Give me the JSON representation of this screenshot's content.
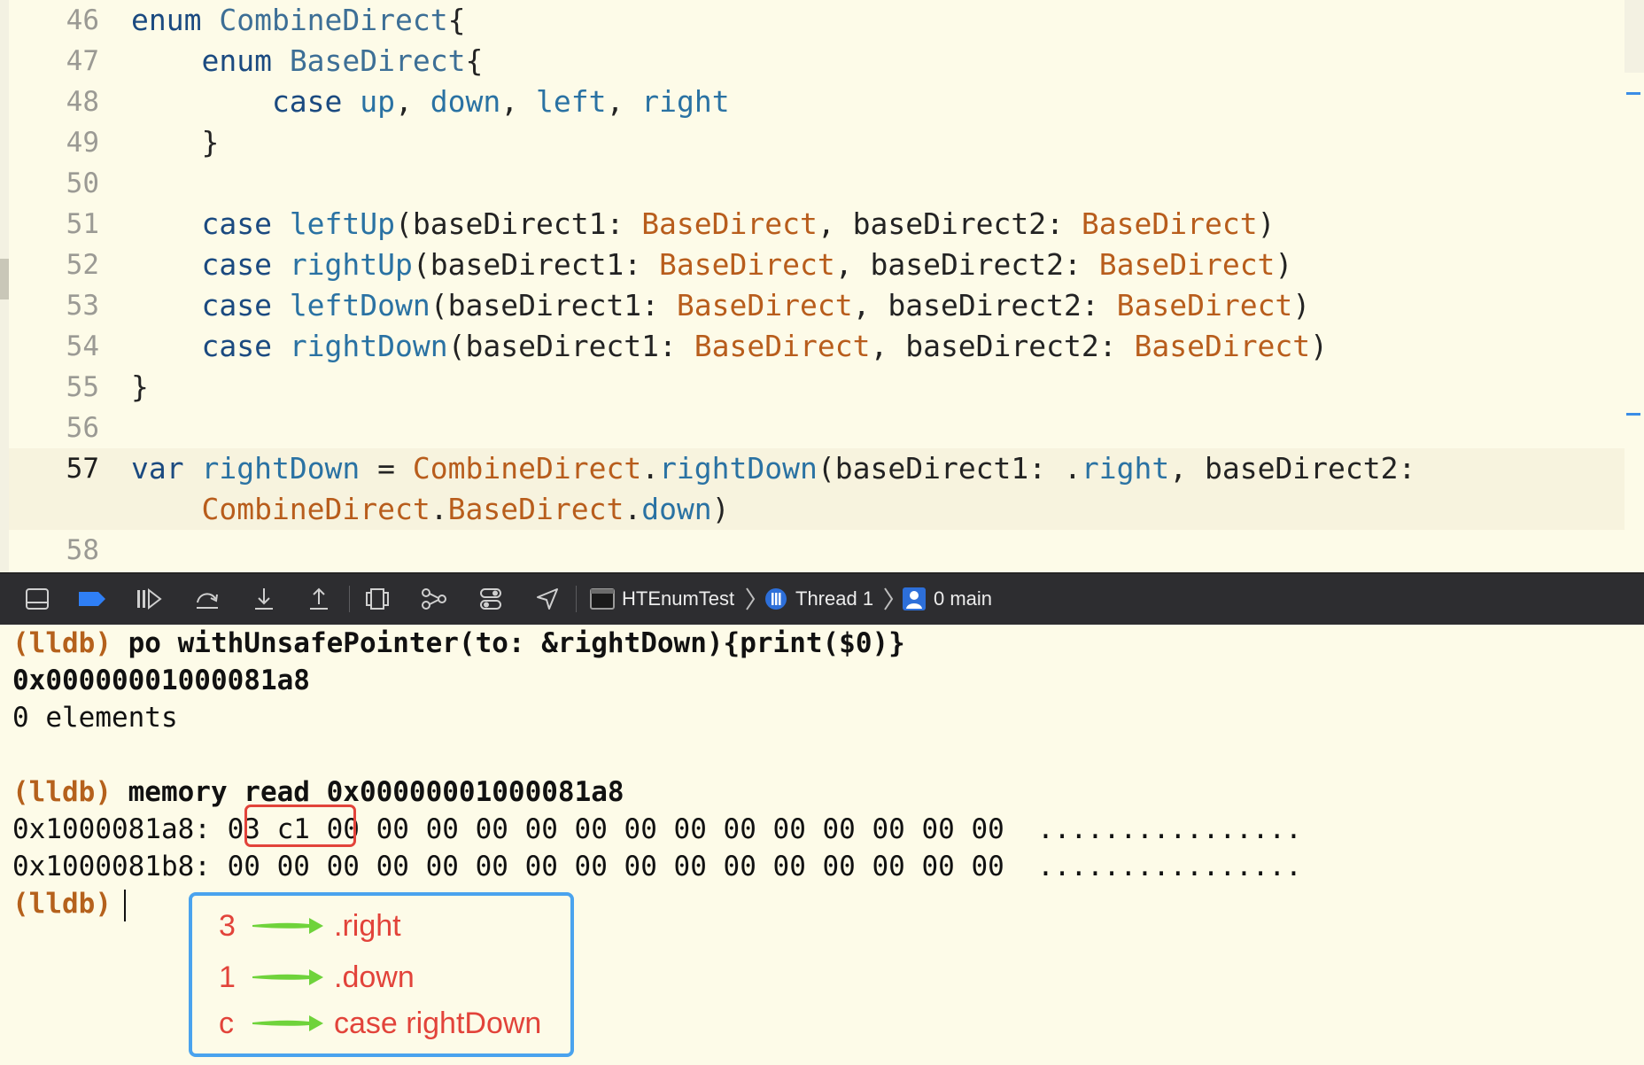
{
  "editor": {
    "lines": [
      {
        "num": "46",
        "segments": [
          {
            "t": "enum ",
            "c": "kw"
          },
          {
            "t": "CombineDirect",
            "c": "ty"
          },
          {
            "t": "{",
            "c": "pl"
          }
        ]
      },
      {
        "num": "47",
        "segments": [
          {
            "t": "    enum ",
            "c": "kw"
          },
          {
            "t": "BaseDirect",
            "c": "ty"
          },
          {
            "t": "{",
            "c": "pl"
          }
        ]
      },
      {
        "num": "48",
        "segments": [
          {
            "t": "        case ",
            "c": "kw"
          },
          {
            "t": "up",
            "c": "id"
          },
          {
            "t": ", ",
            "c": "pl"
          },
          {
            "t": "down",
            "c": "id"
          },
          {
            "t": ", ",
            "c": "pl"
          },
          {
            "t": "left",
            "c": "id"
          },
          {
            "t": ", ",
            "c": "pl"
          },
          {
            "t": "right",
            "c": "id"
          }
        ]
      },
      {
        "num": "49",
        "segments": [
          {
            "t": "    }",
            "c": "pl"
          }
        ]
      },
      {
        "num": "50",
        "segments": []
      },
      {
        "num": "51",
        "segments": [
          {
            "t": "    case ",
            "c": "kw"
          },
          {
            "t": "leftUp",
            "c": "id"
          },
          {
            "t": "(baseDirect1: ",
            "c": "pl"
          },
          {
            "t": "BaseDirect",
            "c": "or"
          },
          {
            "t": ", baseDirect2: ",
            "c": "pl"
          },
          {
            "t": "BaseDirect",
            "c": "or"
          },
          {
            "t": ")",
            "c": "pl"
          }
        ]
      },
      {
        "num": "52",
        "segments": [
          {
            "t": "    case ",
            "c": "kw"
          },
          {
            "t": "rightUp",
            "c": "id"
          },
          {
            "t": "(baseDirect1: ",
            "c": "pl"
          },
          {
            "t": "BaseDirect",
            "c": "or"
          },
          {
            "t": ", baseDirect2: ",
            "c": "pl"
          },
          {
            "t": "BaseDirect",
            "c": "or"
          },
          {
            "t": ")",
            "c": "pl"
          }
        ]
      },
      {
        "num": "53",
        "segments": [
          {
            "t": "    case ",
            "c": "kw"
          },
          {
            "t": "leftDown",
            "c": "id"
          },
          {
            "t": "(baseDirect1: ",
            "c": "pl"
          },
          {
            "t": "BaseDirect",
            "c": "or"
          },
          {
            "t": ", baseDirect2: ",
            "c": "pl"
          },
          {
            "t": "BaseDirect",
            "c": "or"
          },
          {
            "t": ")",
            "c": "pl"
          }
        ]
      },
      {
        "num": "54",
        "segments": [
          {
            "t": "    case ",
            "c": "kw"
          },
          {
            "t": "rightDown",
            "c": "id"
          },
          {
            "t": "(baseDirect1: ",
            "c": "pl"
          },
          {
            "t": "BaseDirect",
            "c": "or"
          },
          {
            "t": ", baseDirect2: ",
            "c": "pl"
          },
          {
            "t": "BaseDirect",
            "c": "or"
          },
          {
            "t": ")",
            "c": "pl"
          }
        ]
      },
      {
        "num": "55",
        "segments": [
          {
            "t": "}",
            "c": "pl"
          }
        ]
      },
      {
        "num": "56",
        "segments": []
      },
      {
        "num": "57",
        "current": true,
        "segments": [
          {
            "t": "var ",
            "c": "kw"
          },
          {
            "t": "rightDown",
            "c": "id"
          },
          {
            "t": " = ",
            "c": "pl"
          },
          {
            "t": "CombineDirect",
            "c": "or"
          },
          {
            "t": ".",
            "c": "pl"
          },
          {
            "t": "rightDown",
            "c": "id"
          },
          {
            "t": "(baseDirect1: .",
            "c": "pl"
          },
          {
            "t": "right",
            "c": "id"
          },
          {
            "t": ", baseDirect2:",
            "c": "pl"
          }
        ]
      },
      {
        "num": "",
        "current": true,
        "segments": [
          {
            "t": "    CombineDirect",
            "c": "or"
          },
          {
            "t": ".",
            "c": "pl"
          },
          {
            "t": "BaseDirect",
            "c": "or"
          },
          {
            "t": ".",
            "c": "pl"
          },
          {
            "t": "down",
            "c": "id"
          },
          {
            "t": ")",
            "c": "pl"
          }
        ]
      },
      {
        "num": "58",
        "segments": []
      }
    ]
  },
  "toolbar": {
    "icons": [
      "hide-debug-area-icon",
      "breakpoints-toggle-icon",
      "continue-icon",
      "step-over-icon",
      "step-into-icon",
      "step-out-icon",
      "debug-view-hierarchy-icon",
      "memory-graph-icon",
      "environment-overrides-icon",
      "simulate-location-icon"
    ],
    "breadcrumb": {
      "target": "HTEnumTest",
      "thread": "Thread 1",
      "frame": "0 main"
    }
  },
  "console": {
    "prompt": "(lldb)",
    "cmd1": " po withUnsafePointer(to: &rightDown){print($0)}",
    "out1": "0x00000001000081a8",
    "out2": "0 elements",
    "cmd2": " memory read 0x00000001000081a8",
    "mem1": "0x1000081a8: 03 c1 00 00 00 00 00 00 00 00 00 00 00 00 00 00  ................",
    "mem2": "0x1000081b8: 00 00 00 00 00 00 00 00 00 00 00 00 00 00 00 00  ................"
  },
  "annotation": {
    "rows": [
      {
        "key": "3",
        "value": ".right"
      },
      {
        "key": "1",
        "value": ".down"
      },
      {
        "key": "c",
        "value": "case rightDown"
      }
    ],
    "colors": {
      "text": "#e2433a",
      "arrow": "#6fd33b",
      "frame": "#4aa3ee"
    }
  }
}
